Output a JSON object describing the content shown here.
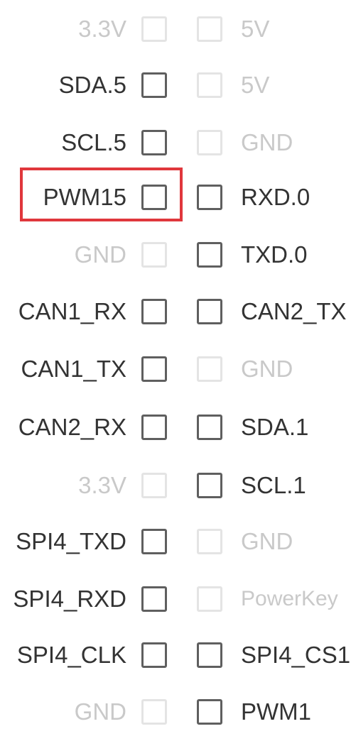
{
  "pins": [
    {
      "left": {
        "label": "3.3V",
        "enabled": false
      },
      "right": {
        "label": "5V",
        "enabled": false
      }
    },
    {
      "left": {
        "label": "SDA.5",
        "enabled": true
      },
      "right": {
        "label": "5V",
        "enabled": false
      }
    },
    {
      "left": {
        "label": "SCL.5",
        "enabled": true
      },
      "right": {
        "label": "GND",
        "enabled": false
      }
    },
    {
      "left": {
        "label": "PWM15",
        "enabled": true
      },
      "right": {
        "label": "RXD.0",
        "enabled": true
      }
    },
    {
      "left": {
        "label": "GND",
        "enabled": false
      },
      "right": {
        "label": "TXD.0",
        "enabled": true
      }
    },
    {
      "left": {
        "label": "CAN1_RX",
        "enabled": true
      },
      "right": {
        "label": "CAN2_TX",
        "enabled": true
      }
    },
    {
      "left": {
        "label": "CAN1_TX",
        "enabled": true
      },
      "right": {
        "label": "GND",
        "enabled": false
      }
    },
    {
      "left": {
        "label": "CAN2_RX",
        "enabled": true
      },
      "right": {
        "label": "SDA.1",
        "enabled": true
      }
    },
    {
      "left": {
        "label": "3.3V",
        "enabled": false
      },
      "right": {
        "label": "SCL.1",
        "enabled": true
      }
    },
    {
      "left": {
        "label": "SPI4_TXD",
        "enabled": true
      },
      "right": {
        "label": "GND",
        "enabled": false
      }
    },
    {
      "left": {
        "label": "SPI4_RXD",
        "enabled": true
      },
      "right": {
        "label": "PowerKey",
        "enabled": false
      }
    },
    {
      "left": {
        "label": "SPI4_CLK",
        "enabled": true
      },
      "right": {
        "label": "SPI4_CS1",
        "enabled": true
      }
    },
    {
      "left": {
        "label": "GND",
        "enabled": false
      },
      "right": {
        "label": "PWM1",
        "enabled": true
      }
    }
  ],
  "highlighted_pin": "PWM15",
  "colors": {
    "enabled_text": "#333333",
    "disabled_text": "#c9c9c9",
    "enabled_border": "#5f5f5f",
    "disabled_border": "#e4e4e4",
    "highlight": "#e0373c"
  }
}
